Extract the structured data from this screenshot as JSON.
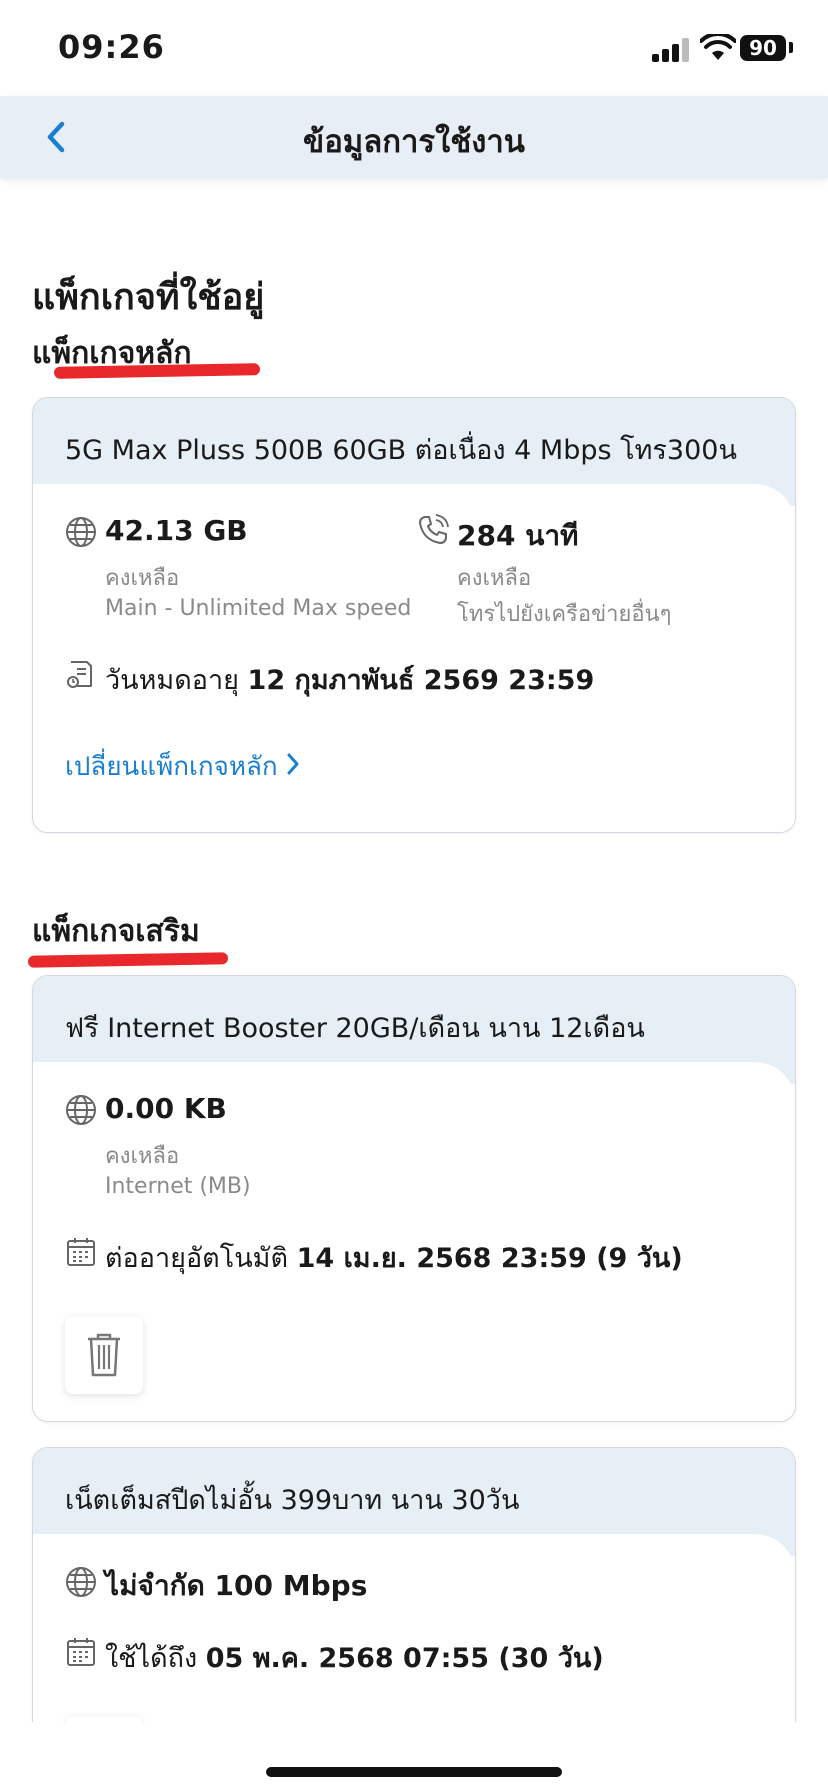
{
  "status_bar": {
    "time": "09:26",
    "battery": "90"
  },
  "header": {
    "title": "ข้อมูลการใช้งาน"
  },
  "page": {
    "current_packages_title": "แพ็กเกจที่ใช้อยู่"
  },
  "main_package": {
    "section_title": "แพ็กเกจหลัก",
    "name": "5G Max Pluss 500B 60GB ต่อเนื่อง 4 Mbps โทร300น",
    "data_value": "42.13 GB",
    "data_remaining": "คงเหลือ",
    "data_desc": "Main - Unlimited Max speed",
    "call_value": "284 นาที",
    "call_remaining": "คงเหลือ",
    "call_desc": "โทรไปยังเครือข่ายอื่นๆ",
    "expiry_label": "วันหมดอายุ",
    "expiry_value": "12 กุมภาพันธ์ 2569 23:59",
    "change_link": "เปลี่ยนแพ็กเกจหลัก"
  },
  "addon_section": {
    "section_title": "แพ็กเกจเสริม"
  },
  "addon_1": {
    "name": "ฟรี Internet Booster 20GB/เดือน นาน 12เดือน",
    "data_value": "0.00 KB",
    "data_remaining": "คงเหลือ",
    "data_desc": "Internet (MB)",
    "renew_label": "ต่ออายุอัตโนมัติ",
    "renew_value": "14 เม.ย. 2568 23:59 (9 วัน)"
  },
  "addon_2": {
    "name": "เน็ตเต็มสปีดไม่อั้น 399บาท นาน 30วัน",
    "data_value": "ไม่จำกัด 100 Mbps",
    "valid_label": "ใช้ได้ถึง",
    "valid_value": "05 พ.ค. 2568 07:55 (30 วัน)"
  },
  "colors": {
    "accent": "#1a7fd0",
    "header_bg": "#e8eef5",
    "card_head_bg": "#e6eef6",
    "annotation_red": "#e8282b"
  },
  "icons": [
    "back-chevron-icon",
    "globe-icon",
    "phone-icon",
    "expiry-document-icon",
    "chevron-right-icon",
    "calendar-icon",
    "trash-icon"
  ]
}
